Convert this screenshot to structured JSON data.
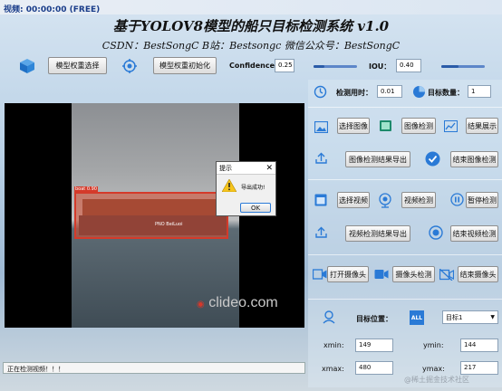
{
  "window": {
    "title": "视频: 00:00:00 (FREE)"
  },
  "header": {
    "title": "基于YOLOV8模型的船只目标检测系统 v1.0",
    "subtitle": "CSDN：BestSongC  B站：Bestsongc  微信公众号：BestSongC"
  },
  "toolbar": {
    "select_weights": "模型权重选择",
    "init_weights": "模型权重初始化",
    "confidence_label": "Confidence:",
    "confidence_value": "0.25",
    "confidence_level": 0.25,
    "iou_label": "IOU：",
    "iou_value": "0.40",
    "iou_level": 0.4
  },
  "stats": {
    "time_label": "检测用时：",
    "time_value": "0.01",
    "count_label": "目标数量：",
    "count_value": "1"
  },
  "image_section": {
    "select_image": "选择图像",
    "detect_image": "图像检测",
    "show_result": "结果展示",
    "export_image": "图像检测结果导出",
    "end_image": "结束图像检测"
  },
  "video_section": {
    "select_video": "选择视频",
    "detect_video": "视频检测",
    "pause_detect": "暂停检测",
    "export_video": "视频检测结果导出",
    "end_video": "结束视频检测"
  },
  "camera_section": {
    "open_camera": "打开摄像头",
    "detect_camera": "摄像头检测",
    "end_camera": "结束摄像头"
  },
  "target": {
    "position_label": "目标位置：",
    "all_badge": "ALL",
    "select_value": "目标1",
    "xmin_label": "xmin:",
    "xmin_value": "149",
    "ymin_label": "ymin:",
    "ymin_value": "144",
    "xmax_label": "xmax:",
    "xmax_value": "480",
    "ymax_label": "ymax:",
    "ymax_value": "217"
  },
  "preview": {
    "ship_class_label": "boat 0.90",
    "ship_name": "PNO BeiLuoi",
    "watermark": "clideo.com"
  },
  "dialog": {
    "title": "提示",
    "message": "导出成功!",
    "ok": "OK"
  },
  "status": {
    "text": "正在检测视频！！！"
  },
  "footer": {
    "watermark": "@稀土掘金技术社区"
  },
  "colors": {
    "accent": "#2a7ad6",
    "slider": "#5d86c9",
    "detection_box": "#d43a2a"
  }
}
